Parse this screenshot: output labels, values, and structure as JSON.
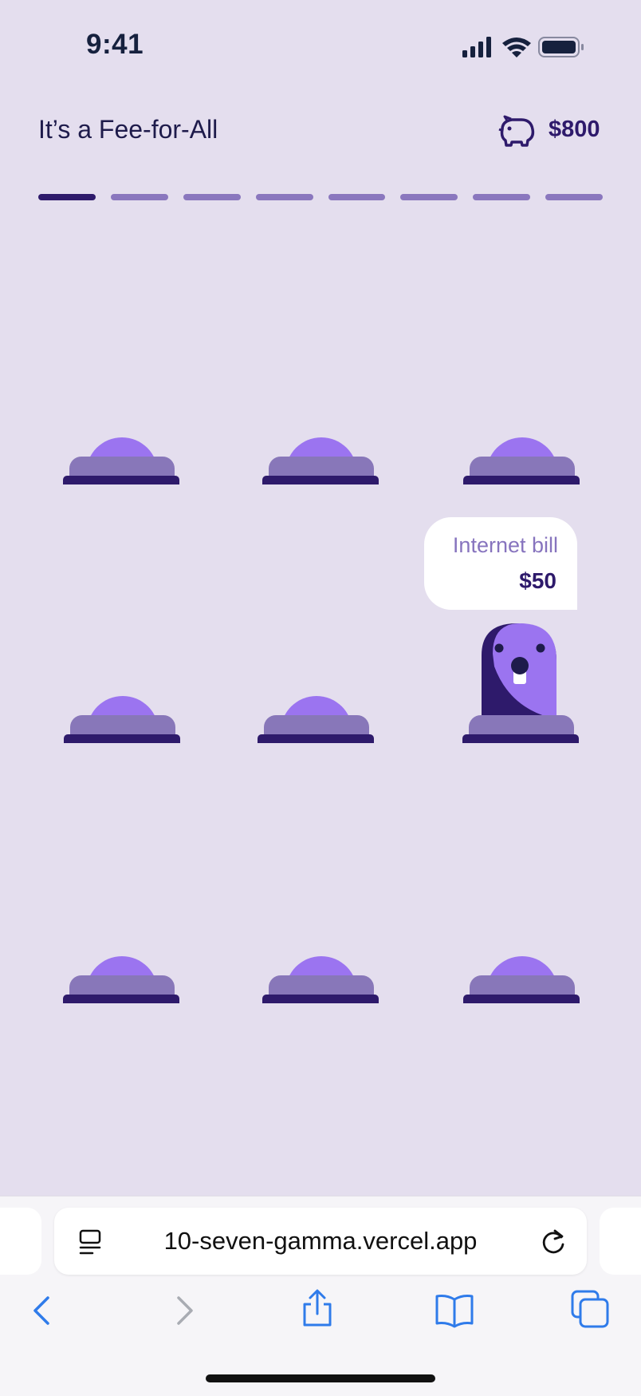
{
  "status_bar": {
    "time": "9:41"
  },
  "header": {
    "title": "It’s a Fee-for-All",
    "balance": "$800"
  },
  "progress": {
    "total_steps": 8,
    "current_step": 1
  },
  "holes": [
    {
      "id": "hole-1",
      "occupied": false
    },
    {
      "id": "hole-2",
      "occupied": false
    },
    {
      "id": "hole-3",
      "occupied": false
    },
    {
      "id": "hole-4",
      "occupied": false
    },
    {
      "id": "hole-5",
      "occupied": false
    },
    {
      "id": "hole-6",
      "occupied": true
    },
    {
      "id": "hole-7",
      "occupied": false
    },
    {
      "id": "hole-8",
      "occupied": false
    },
    {
      "id": "hole-9",
      "occupied": false
    }
  ],
  "bubble": {
    "label": "Internet bill",
    "amount": "$50"
  },
  "browser": {
    "url": "10-seven-gamma.vercel.app"
  },
  "icons": {
    "status": [
      "signal-icon",
      "wifi-icon",
      "battery-icon"
    ],
    "header": "piggy-bank-icon",
    "url_bar": [
      "reader-mode-icon",
      "reload-icon"
    ],
    "toolbar": [
      "back-icon",
      "forward-icon",
      "share-icon",
      "bookmarks-icon",
      "tabs-icon"
    ]
  },
  "colors": {
    "background": "#E4DEEE",
    "accent": "#9B74F0",
    "dark": "#2E1A6B",
    "muted": "#8877B9",
    "browser_blue": "#2F7BEA"
  }
}
